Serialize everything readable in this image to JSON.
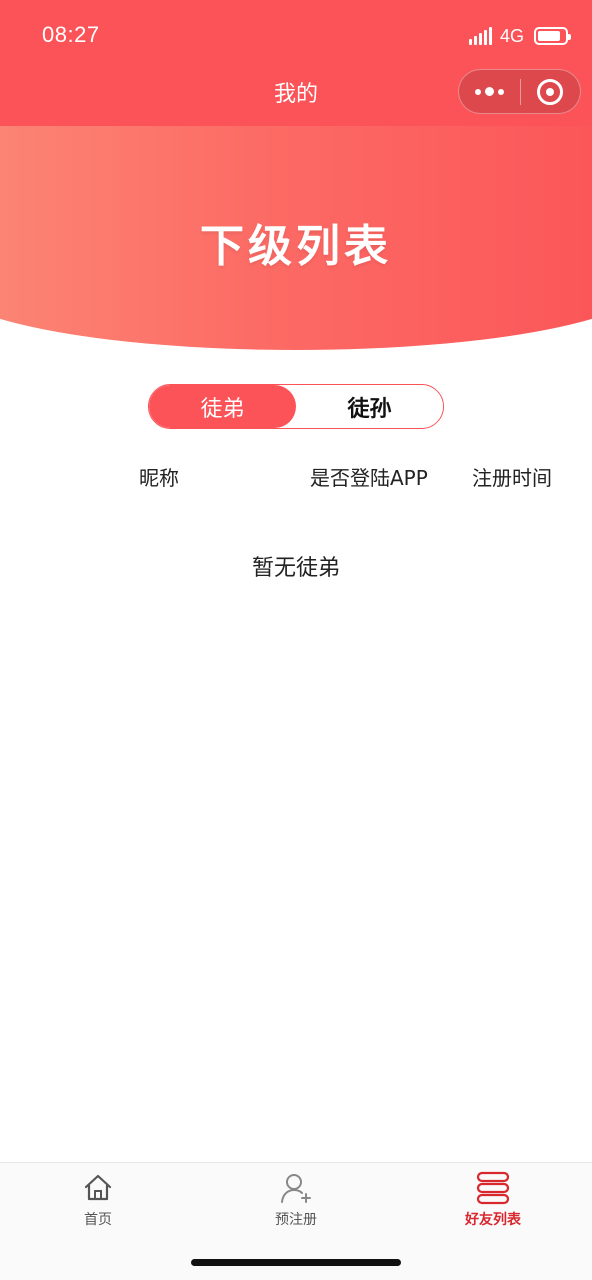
{
  "status": {
    "time": "08:27",
    "network": "4G"
  },
  "nav": {
    "title": "我的"
  },
  "banner": {
    "title": "下级列表"
  },
  "tabs": [
    {
      "label": "徒弟",
      "active": true
    },
    {
      "label": "徒孙",
      "active": false
    }
  ],
  "table": {
    "columns": [
      "昵称",
      "是否登陆APP",
      "注册时间"
    ],
    "rows": [],
    "empty_text": "暂无徒弟"
  },
  "tabbar": {
    "items": [
      {
        "label": "首页",
        "icon": "home-icon",
        "active": false
      },
      {
        "label": "预注册",
        "icon": "user-add-icon",
        "active": false
      },
      {
        "label": "好友列表",
        "icon": "list-icon",
        "active": true
      }
    ]
  },
  "colors": {
    "primary": "#fb5357",
    "active_tab_text": "#d9272e",
    "banner_start": "#fb8a78"
  }
}
